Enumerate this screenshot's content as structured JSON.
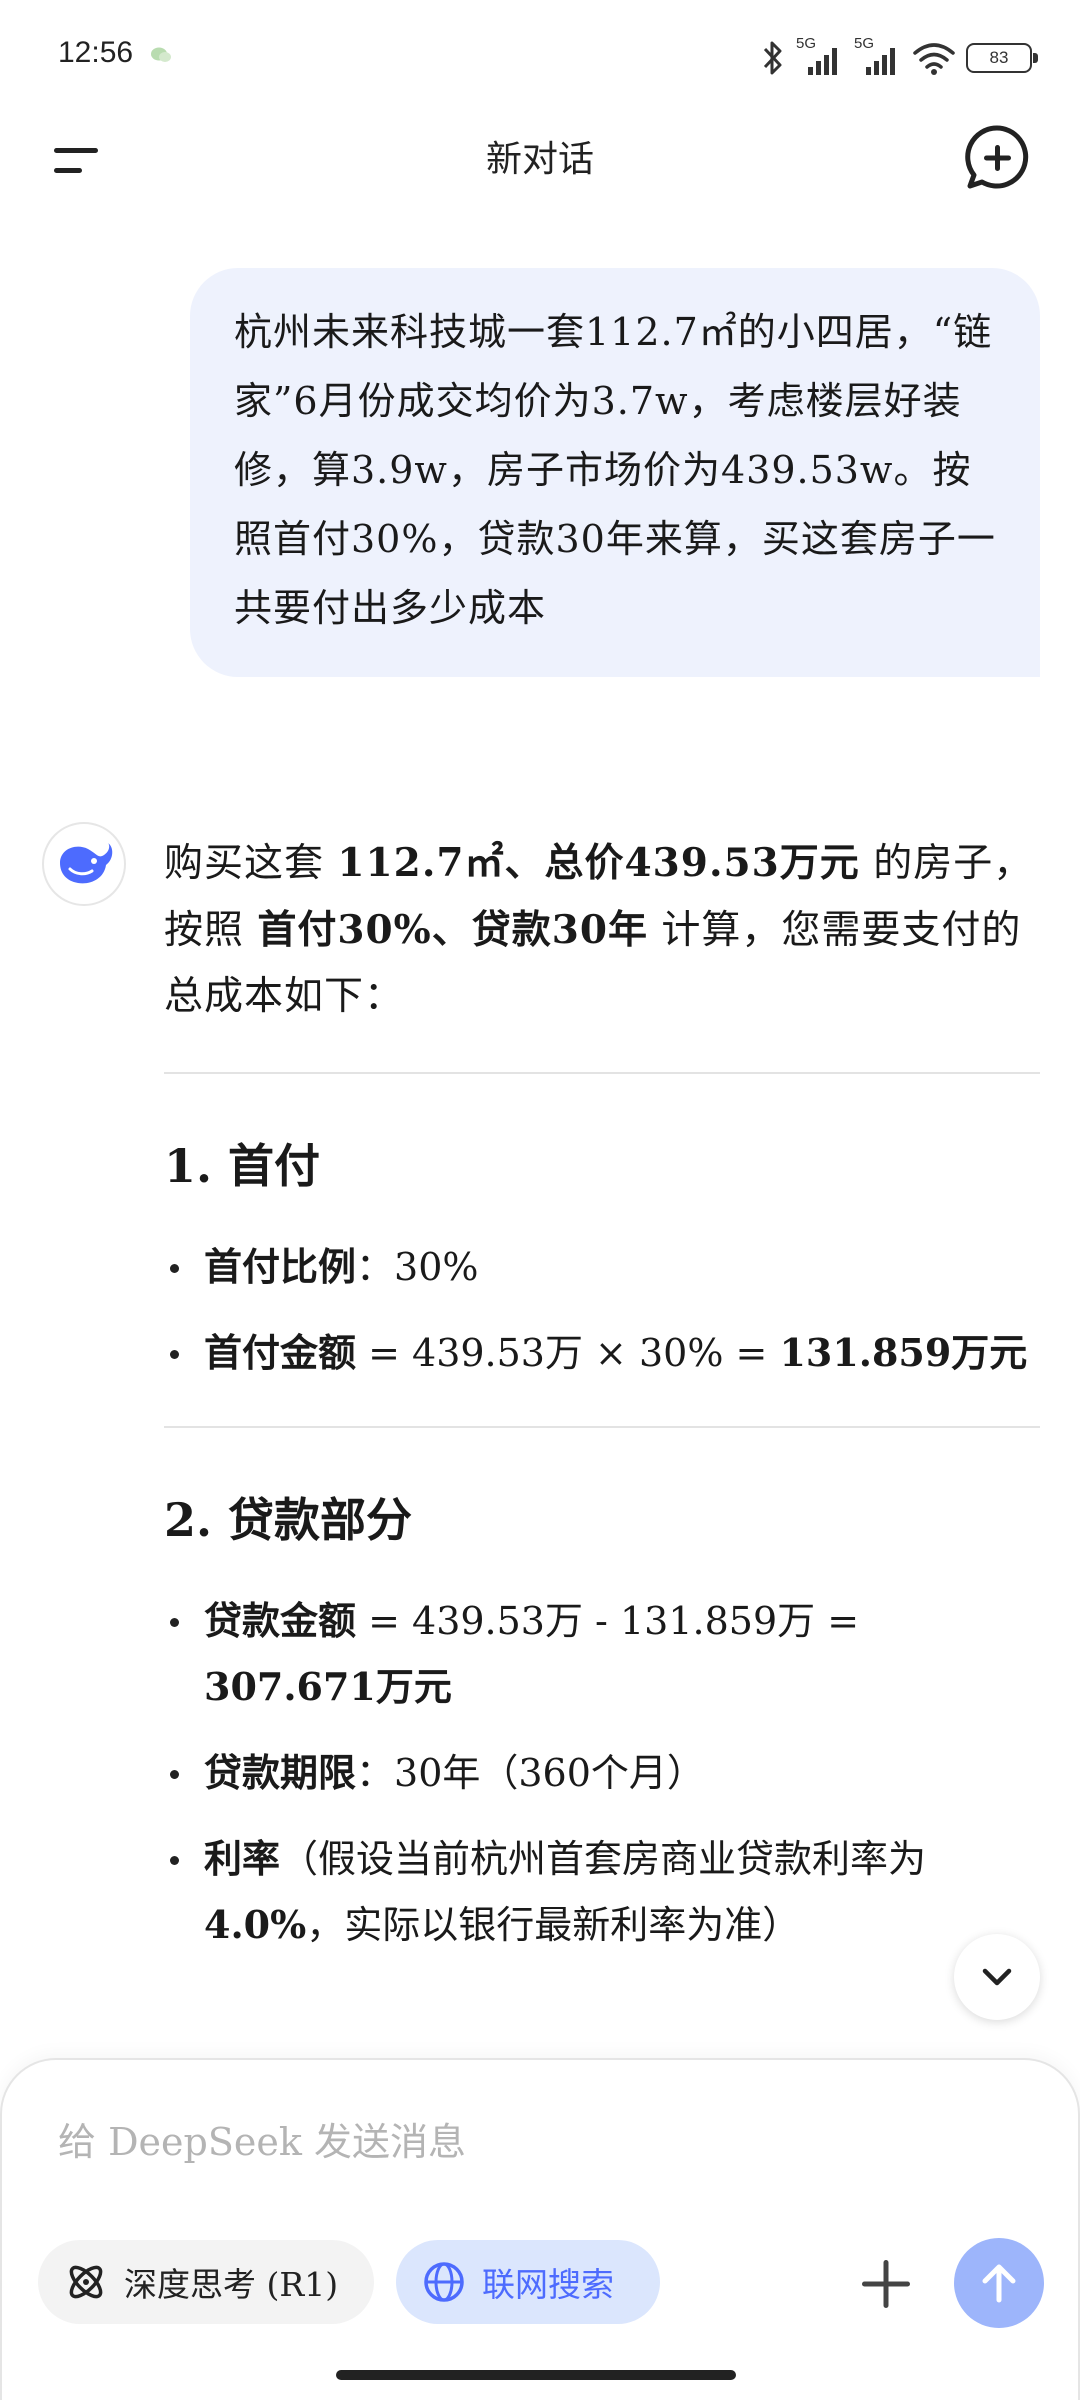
{
  "status": {
    "time": "12:56",
    "network1": "5G",
    "network2": "5G",
    "battery": "83"
  },
  "header": {
    "title": "新对话"
  },
  "user_message": {
    "text": "杭州未来科技城一套112.7㎡的小四居，“链家”6月份成交均价为3.7w，考虑楼层好装修，算3.9w，房子市场价为439.53w。按照首付30%，贷款30年来算，买这套房子一共要付出多少成本"
  },
  "answer": {
    "intro": {
      "p1": "购买这套 ",
      "b1": "112.7㎡、总价439.53万元",
      "p2": " 的房子，按照 ",
      "b2": "首付30%、贷款30年",
      "p3": " 计算，您需要支付的总成本如下："
    },
    "sections": [
      {
        "heading": "1. 首付",
        "items": [
          {
            "label": "首付比例",
            "rest": "：30%",
            "bold_tail": ""
          },
          {
            "label": "首付金额",
            "rest": " = 439.53万 × 30% = ",
            "bold_tail": "131.859万元"
          }
        ]
      },
      {
        "heading": "2. 贷款部分",
        "items": [
          {
            "label": "贷款金额",
            "rest": " = 439.53万 - 131.859万 = ",
            "bold_tail": "307.671万元"
          },
          {
            "label": "贷款期限",
            "rest": "：30年（360个月）",
            "bold_tail": ""
          },
          {
            "label": "利率",
            "rest": "（假设当前杭州首套房商业贷款利率为 ",
            "bold_tail": "4.0%",
            "tail": "，实际以银行最新利率为准）"
          }
        ]
      }
    ]
  },
  "composer": {
    "placeholder": "给 DeepSeek 发送消息",
    "deep_think_label": "深度思考 (R1)",
    "web_search_label": "联网搜索"
  },
  "colors": {
    "accent": "#4d6bfe",
    "bubble": "#eef2fd",
    "send_disabled": "#9db5fb"
  }
}
